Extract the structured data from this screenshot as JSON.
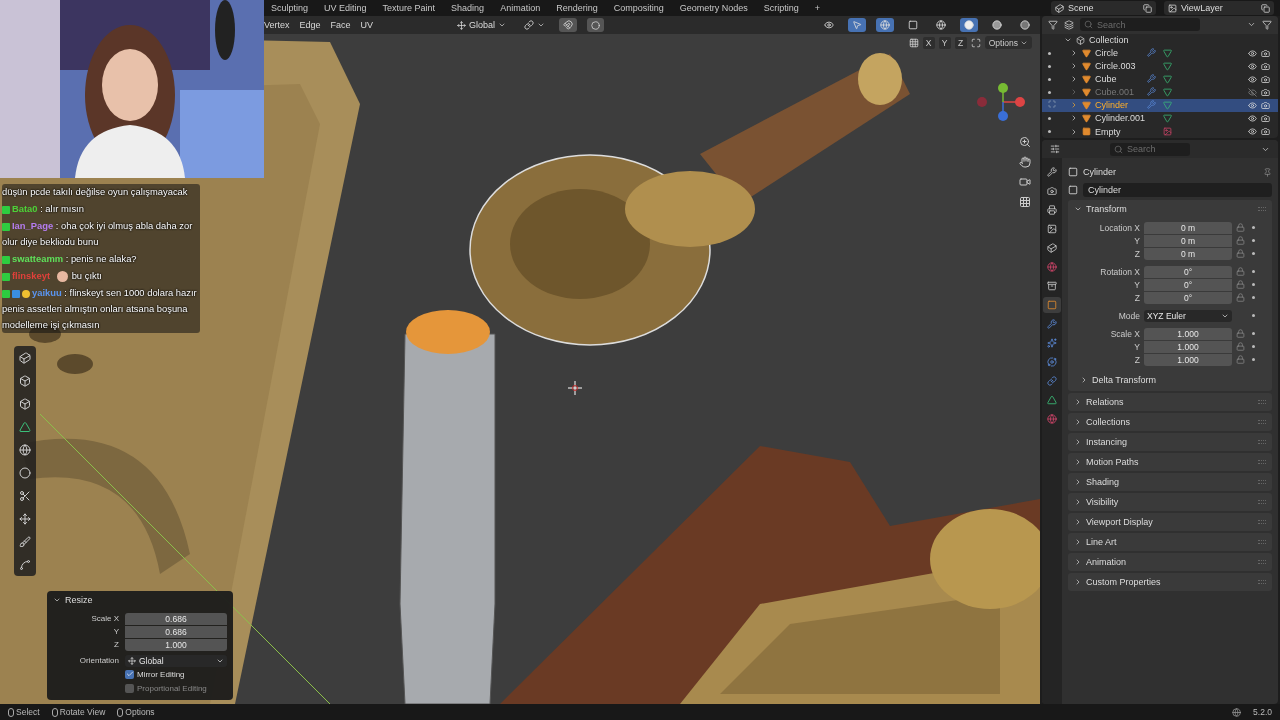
{
  "workspace_tabs": [
    {
      "label": "Sculpting",
      "selected": false
    },
    {
      "label": "UV Editing",
      "selected": false
    },
    {
      "label": "Texture Paint",
      "selected": false
    },
    {
      "label": "Shading",
      "selected": false
    },
    {
      "label": "Animation",
      "selected": false
    },
    {
      "label": "Rendering",
      "selected": false
    },
    {
      "label": "Compositing",
      "selected": false
    },
    {
      "label": "Geometry Nodes",
      "selected": false
    },
    {
      "label": "Scripting",
      "selected": false
    }
  ],
  "add_tab": "+",
  "scene": "Scene",
  "view_layer": "ViewLayer",
  "viewport_header": {
    "menus": [
      "Vertex",
      "Edge",
      "Face",
      "UV"
    ],
    "orientation": "Global",
    "axes": [
      "X",
      "Y",
      "Z"
    ],
    "options": "Options"
  },
  "chat": [
    {
      "message": "düşün pcde takılı değilse oyun çalışmayacak"
    },
    {
      "user": "Bata0",
      "color": "#4cd137",
      "message": ": alır mısın",
      "extra_badges": false,
      "emote": false
    },
    {
      "user": "Ian_Page",
      "color": "#b47cf0",
      "message": ": oha çok iyi olmuş abla daha zor olur diye bekliodu bunu",
      "extra_badges": false,
      "emote": false
    },
    {
      "user": "swatteamm",
      "color": "#5ee05a",
      "message": ": penis ne alaka?",
      "extra_badges": false,
      "emote": false
    },
    {
      "user": "flinskeyt",
      "color": "#e0403a",
      "message": "bu çıktı",
      "extra_badges": false,
      "emote": true
    },
    {
      "user": "yaikuu",
      "color": "#5a95f0",
      "message": ": flinskeyt sen 1000 dolara hazır penis assetleri almıştın onları atsana boşuna modelleme işi çıkmasın",
      "extra_badges": true,
      "emote": false
    }
  ],
  "outliner": {
    "search": {
      "placeholder": "Search"
    },
    "collection": "Collection",
    "items": [
      {
        "name": "Circle",
        "kind": "mesh",
        "modifier": true,
        "selected": false,
        "hidden": false
      },
      {
        "name": "Circle.003",
        "kind": "mesh",
        "modifier": false,
        "selected": false,
        "hidden": false
      },
      {
        "name": "Cube",
        "kind": "mesh",
        "modifier": true,
        "selected": false,
        "hidden": false
      },
      {
        "name": "Cube.001",
        "kind": "mesh",
        "modifier": true,
        "selected": false,
        "hidden": true
      },
      {
        "name": "Cylinder",
        "kind": "mesh",
        "modifier": true,
        "selected": true,
        "hidden": false
      },
      {
        "name": "Cylinder.001",
        "kind": "mesh",
        "modifier": false,
        "selected": false,
        "hidden": false
      },
      {
        "name": "Empty",
        "kind": "empty",
        "modifier": false,
        "selected": false,
        "hidden": false
      }
    ]
  },
  "properties": {
    "search": {
      "placeholder": "Search"
    },
    "tabs": [
      {
        "kind": "tool",
        "selected": false
      },
      {
        "kind": "render",
        "selected": false
      },
      {
        "kind": "output",
        "selected": false
      },
      {
        "kind": "view_layer",
        "selected": false
      },
      {
        "kind": "scene",
        "selected": false
      },
      {
        "kind": "world",
        "selected": false
      },
      {
        "kind": "collection",
        "selected": false
      },
      {
        "kind": "object",
        "selected": true
      },
      {
        "kind": "modifiers",
        "selected": false
      },
      {
        "kind": "particles",
        "selected": false
      },
      {
        "kind": "physics",
        "selected": false
      },
      {
        "kind": "constraints",
        "selected": false
      },
      {
        "kind": "data",
        "selected": false
      },
      {
        "kind": "material",
        "selected": false
      }
    ],
    "object_title": "Cylinder",
    "object_name": "Cylinder",
    "transform": {
      "title": "Transform",
      "expanded": true,
      "groups": [
        {
          "rows": [
            {
              "label": "Location X",
              "value": "0 m"
            },
            {
              "label": "Y",
              "value": "0 m"
            },
            {
              "label": "Z",
              "value": "0 m"
            }
          ]
        },
        {
          "rows": [
            {
              "label": "Rotation X",
              "value": "0°"
            },
            {
              "label": "Y",
              "value": "0°"
            },
            {
              "label": "Z",
              "value": "0°"
            }
          ]
        },
        {
          "mode_label": "Mode",
          "mode": "XYZ Euler"
        },
        {
          "rows": [
            {
              "label": "Scale X",
              "value": "1.000"
            },
            {
              "label": "Y",
              "value": "1.000"
            },
            {
              "label": "Z",
              "value": "1.000"
            }
          ]
        }
      ],
      "subpanel": "Delta Transform"
    },
    "panels": [
      {
        "title": "Relations",
        "expanded": false
      },
      {
        "title": "Collections",
        "expanded": false
      },
      {
        "title": "Instancing",
        "expanded": false
      },
      {
        "title": "Motion Paths",
        "expanded": false
      },
      {
        "title": "Shading",
        "expanded": false
      },
      {
        "title": "Visibility",
        "expanded": false
      },
      {
        "title": "Viewport Display",
        "expanded": false
      },
      {
        "title": "Line Art",
        "expanded": false
      },
      {
        "title": "Animation",
        "expanded": false
      },
      {
        "title": "Custom Properties",
        "expanded": false
      }
    ]
  },
  "resize_panel": {
    "title": "Resize",
    "rows": [
      {
        "label": "Scale X",
        "value": "0.686"
      },
      {
        "label": "Y",
        "value": "0.686"
      },
      {
        "label": "Z",
        "value": "1.000"
      }
    ],
    "orientation_label": "Orientation",
    "orientation": "Global",
    "checks": [
      {
        "label": "Mirror Editing",
        "checked": true
      },
      {
        "label": "Proportional Editing",
        "checked": false
      }
    ]
  },
  "status_bar": {
    "items": [
      "Select",
      "Rotate View",
      "Options"
    ],
    "version": "5.2.0"
  }
}
